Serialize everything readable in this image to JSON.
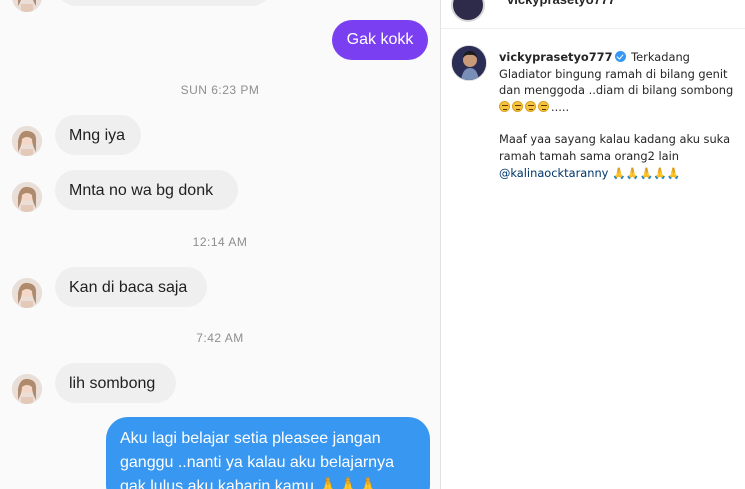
{
  "chat": {
    "messages": [
      {
        "text": "Gak kokk"
      },
      {
        "text": "Mng iya"
      },
      {
        "text": "Mnta no wa bg donk"
      },
      {
        "text": "Kan di baca saja"
      },
      {
        "text": "lih sombong"
      },
      {
        "text": "Aku lagi belajar setia pleasee jangan ganggu ..nanti ya kalau aku belajarnya gak lulus aku kabarin kamu"
      }
    ],
    "timestamps": [
      "SUN 6:23 PM",
      "12:14 AM",
      "7:42 AM"
    ],
    "blue_emoji": "🙏🙏🙏"
  },
  "post": {
    "username": "vickyprasetyo777",
    "caption_line1": "Terkadang Gladiator bingung ramah di bilang genit dan menggoda ..diam di bilang sombong",
    "caption_emoji": "😑😑😑😑",
    "caption_trail": ".....",
    "caption_line2": "Maaf yaa sayang kalau kadang aku suka ramah tamah sama orang2 lain",
    "mention": "@kalinaocktaranny",
    "mention_emoji": "🙏🙏🙏🙏🙏"
  },
  "colors": {
    "purple_bubble": "#7b3ff2",
    "blue_bubble": "#3897f0",
    "incoming_bubble": "#efefef",
    "timestamp": "#8e8e8e",
    "mention": "#00376b"
  }
}
